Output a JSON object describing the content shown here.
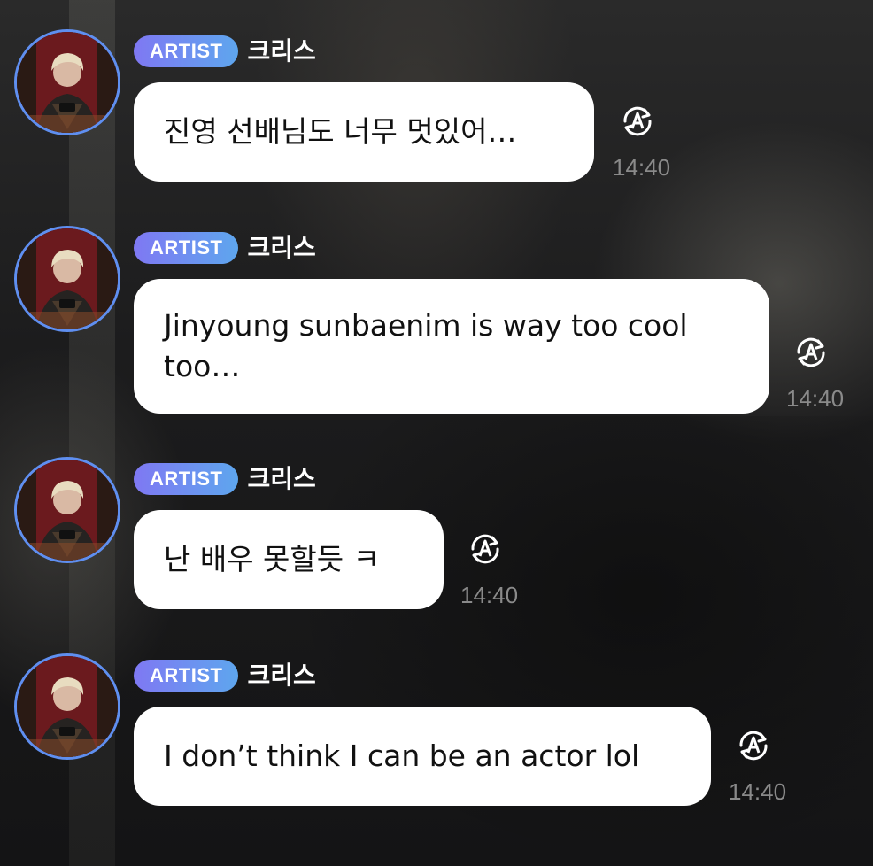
{
  "messages": [
    {
      "badge": "ARTIST",
      "author": "크리스",
      "text": "진영 선배님도 너무 멋있어…",
      "time": "14:40",
      "translate_icon": "translate-icon"
    },
    {
      "badge": "ARTIST",
      "author": "크리스",
      "text": "Jinyoung sunbaenim is way too cool too…",
      "time": "14:40",
      "translate_icon": "translate-icon"
    },
    {
      "badge": "ARTIST",
      "author": "크리스",
      "text": "난 배우 못할듯 ㅋ",
      "time": "14:40",
      "translate_icon": "translate-icon"
    },
    {
      "badge": "ARTIST",
      "author": "크리스",
      "text": "I don’t think I can be an actor lol",
      "time": "14:40",
      "translate_icon": "translate-icon"
    }
  ],
  "colors": {
    "badge_start": "#7f78f3",
    "badge_end": "#5ea6ee",
    "avatar_ring": "#5f8ff0",
    "bubble": "#ffffff",
    "timestamp": "#8a8a8a"
  }
}
